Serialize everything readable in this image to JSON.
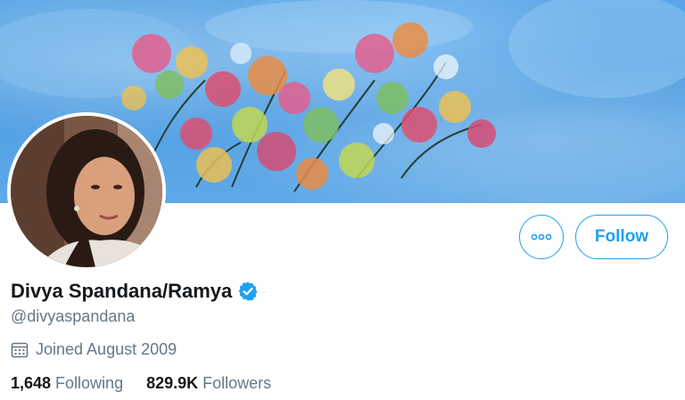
{
  "profile": {
    "display_name": "Divya Spandana/Ramya",
    "handle": "@divyaspandana",
    "joined": "Joined August 2009",
    "following_count": "1,648",
    "following_label": "Following",
    "followers_count": "829.9K",
    "followers_label": "Followers",
    "verified": true
  },
  "actions": {
    "follow_label": "Follow",
    "more_icon": "more-horizontal-icon"
  },
  "icons": {
    "calendar": "calendar-icon",
    "verified": "verified-badge-icon"
  },
  "colors": {
    "accent": "#1da1f2",
    "text_primary": "#14171a",
    "text_secondary": "#657786"
  }
}
